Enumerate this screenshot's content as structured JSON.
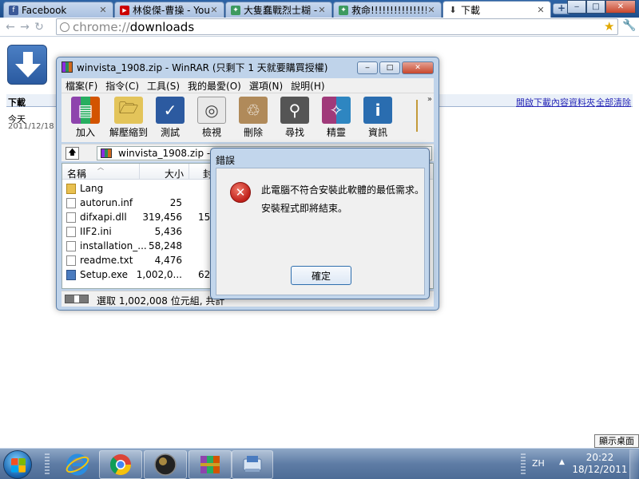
{
  "browser": {
    "tabs": [
      {
        "title": "Facebook",
        "icon": "facebook-icon",
        "color": "#3b5998",
        "glyph": "f"
      },
      {
        "title": "林俊傑-曹操 - You",
        "icon": "youtube-icon",
        "color": "#cc0000",
        "glyph": "▶"
      },
      {
        "title": "大隻蠢戰烈士糊 - ",
        "icon": "forum-icon",
        "color": "#3c9a5f",
        "glyph": "✦"
      },
      {
        "title": "救命!!!!!!!!!!!!!!!!!!!",
        "icon": "forum-icon",
        "color": "#3c9a5f",
        "glyph": "✦"
      },
      {
        "title": "下載",
        "icon": "download-icon",
        "color": "#555555",
        "glyph": "⬇"
      }
    ],
    "new_tab": "+",
    "window_buttons": {
      "minimize": "‒",
      "maximize": "□",
      "close": "✕"
    },
    "url_scheme": "chrome://",
    "url_host": "downloads"
  },
  "downloads_page": {
    "title": "下載",
    "open_folder_link": "開啟下載內容資料夾",
    "clear_all_link": "全部清除",
    "date_label": "今天",
    "date": "2011/12/18"
  },
  "winrar": {
    "title": "winvista_1908.zip - WinRAR (只剩下 1 天就要購買授權)",
    "menu": [
      "檔案(F)",
      "指令(C)",
      "工具(S)",
      "我的最愛(O)",
      "選項(N)",
      "說明(H)"
    ],
    "tools": [
      {
        "label": "加入",
        "icon": "add-icon",
        "color": "#8e44ad",
        "glyph": "▤"
      },
      {
        "label": "解壓縮到",
        "icon": "extract-icon",
        "color": "#c9a227",
        "glyph": "🗁"
      },
      {
        "label": "測試",
        "icon": "test-icon",
        "color": "#2c5aa0",
        "glyph": "✓"
      },
      {
        "label": "檢視",
        "icon": "view-icon",
        "color": "#999999",
        "glyph": "◎"
      },
      {
        "label": "刪除",
        "icon": "delete-icon",
        "color": "#7a5c3a",
        "glyph": "♲"
      },
      {
        "label": "尋找",
        "icon": "find-icon",
        "color": "#444444",
        "glyph": "⚲"
      },
      {
        "label": "精靈",
        "icon": "wizard-icon",
        "color": "#a03a7a",
        "glyph": "✧"
      },
      {
        "label": "資訊",
        "icon": "info-icon",
        "color": "#2a6db0",
        "glyph": "i"
      }
    ],
    "more_chevron": "»",
    "path": "winvista_1908.zip - ZIP",
    "columns": {
      "name": "名稱",
      "size": "大小",
      "packed": "封"
    },
    "files": [
      {
        "name": "Lang",
        "size": "",
        "packed": "",
        "type": "folder"
      },
      {
        "name": "autorun.inf",
        "size": "25",
        "packed": "",
        "type": "file"
      },
      {
        "name": "difxapi.dll",
        "size": "319,456",
        "packed": "15",
        "type": "file"
      },
      {
        "name": "IIF2.ini",
        "size": "5,436",
        "packed": "",
        "type": "file"
      },
      {
        "name": "installation_...",
        "size": "58,248",
        "packed": "",
        "type": "file"
      },
      {
        "name": "readme.txt",
        "size": "4,476",
        "packed": "",
        "type": "file"
      },
      {
        "name": "Setup.exe",
        "size": "1,002,0...",
        "packed": "62",
        "type": "exe"
      }
    ],
    "status": "選取 1,002,008 位元組, 共計"
  },
  "error_dialog": {
    "title": "錯誤",
    "message_line1": "此電腦不符合安裝此軟體的最低需求。",
    "message_line2": "安裝程式即將結束。",
    "ok_label": "確定",
    "icon_glyph": "✕"
  },
  "tooltip": "顯示桌面",
  "taskbar": {
    "language": "ZH",
    "tray_arrow": "▲",
    "time": "20:22",
    "date": "18/12/2011"
  }
}
